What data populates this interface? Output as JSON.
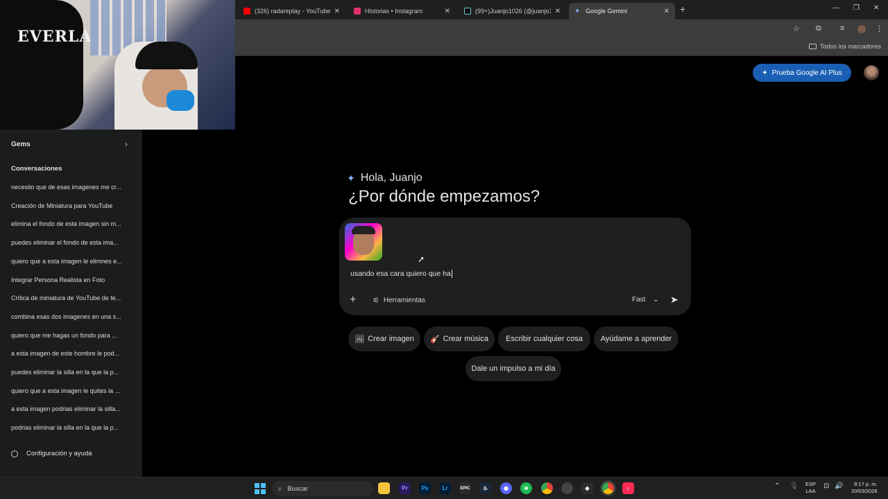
{
  "browser": {
    "tabs": [
      {
        "label": "(326) radareplay - YouTube",
        "favicon_color": "#ff0000",
        "active": false
      },
      {
        "label": "Historias • Instagram",
        "favicon_color": "#e1306c",
        "active": false
      },
      {
        "label": "(99+)Juanjo1026 (@juanjo1026",
        "favicon_color": "#111111",
        "active": false
      },
      {
        "label": "Google Gemini",
        "favicon_color": "#8ab4f8",
        "active": true
      }
    ],
    "new_tab": "+",
    "bookmarks_label": "Todos los marcadores"
  },
  "webcam": {
    "bag_text": "EVERLA"
  },
  "sidebar": {
    "gems_label": "Gems",
    "conversations_heading": "Conversaciones",
    "conversations": [
      "necesito que de esas imagenes me cr...",
      "Creación de Miniatura para YouTube",
      "elimina el fondo de esta imagen sin m...",
      "puedes eliminar el fondo de esta ima...",
      "quiero que a esta imagen le elimnes e...",
      "Integrar Persona Realista en Foto",
      "Crítica de miniatura de YouTube de te...",
      "combina esas dos imagenes en una s...",
      "quiero que me hagas un fondo para ...",
      "a esta imagen de este hombre le pod...",
      "puedes eliminar la silla en la que la p...",
      "quiero que a esta imagen le quites la ...",
      "a esta imagen podrias eliminar la silla...",
      "podrias eliminar la silla en la que la p..."
    ],
    "settings_label": "Configuración y ayuda"
  },
  "header": {
    "promo_label": "Prueba Google AI Plus"
  },
  "main": {
    "greeting": "Hola, Juanjo",
    "headline": "¿Por dónde empezamos?",
    "composer": {
      "text": "usando esa cara quiero que ha",
      "tools_label": "Herramientas",
      "mode_label": "Fast"
    },
    "chips": [
      {
        "label": "Crear imagen",
        "icon": "🖼"
      },
      {
        "label": "Crear música",
        "icon": "🎸"
      },
      {
        "label": "Escribir cualquier cosa",
        "icon": ""
      },
      {
        "label": "Ayúdame a aprender",
        "icon": ""
      },
      {
        "label": "Dale un impulso a mi día",
        "icon": ""
      }
    ]
  },
  "taskbar": {
    "search_label": "Buscar",
    "lang_line1": "ESP",
    "lang_line2": "LAA",
    "time": "8:17 p. m.",
    "date": "20/03/2026"
  },
  "colors": {
    "accent": "#1a5fb4",
    "surface": "#1e1f20",
    "sidebar": "#1b1c1d"
  }
}
